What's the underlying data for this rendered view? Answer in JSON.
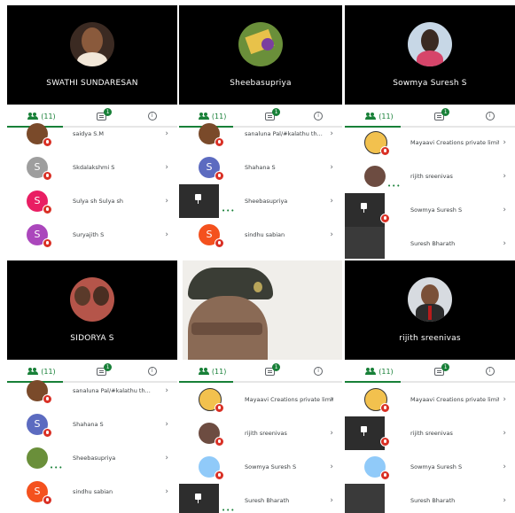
{
  "colors": {
    "accent": "#188038",
    "muted_red": "#d93025",
    "purple": "#9c27b0",
    "blue": "#5c6bc0",
    "pink": "#e91e63",
    "orange": "#f4511e"
  },
  "tabs": {
    "people_count": "(11)",
    "chat_badge": "1"
  },
  "videos": [
    {
      "name": "SWATHI SUNDARESAN"
    },
    {
      "name": "Sheebasupriya"
    },
    {
      "name": "Sowmya Suresh S"
    },
    {
      "name": "SIDORYA S"
    },
    {
      "name": ""
    },
    {
      "name": "rijith sreenivas"
    }
  ],
  "panels": [
    {
      "rows": [
        {
          "name": "saidya S.M",
          "avatar": "photo"
        },
        {
          "name": "Skdalakshmi S",
          "avatar": "S",
          "color": "#9e9e9e"
        },
        {
          "name": "Sulya sh Sulya sh",
          "avatar": "S",
          "color": "#e91e63"
        },
        {
          "name": "Suryajith S",
          "avatar": "S",
          "color": "#ab47bc"
        }
      ]
    },
    {
      "rows": [
        {
          "name": "sanaluna Pal/#kalathu th...",
          "avatar": "photo"
        },
        {
          "name": "Shahana S",
          "avatar": "S",
          "color": "#5c6bc0"
        },
        {
          "name": "Sheebasupriya",
          "avatar": "pin"
        },
        {
          "name": "sindhu sabian",
          "avatar": "S",
          "color": "#f4511e"
        }
      ]
    },
    {
      "rows": [
        {
          "name": "Mayaavi Creations private limite...",
          "avatar": "photo"
        },
        {
          "name": "rijith sreenivas",
          "avatar": "photo"
        },
        {
          "name": "Sowmya Suresh S",
          "avatar": "pin"
        },
        {
          "name": "Suresh Bharath",
          "avatar": "photo"
        }
      ]
    },
    {
      "rows": [
        {
          "name": "sanaluna Pal/#kalathu th...",
          "avatar": "photo"
        },
        {
          "name": "Shahana S",
          "avatar": "S",
          "color": "#5c6bc0"
        },
        {
          "name": "Sheebasupriya",
          "avatar": "photo"
        },
        {
          "name": "sindhu sabian",
          "avatar": "S",
          "color": "#f4511e"
        }
      ]
    },
    {
      "rows": [
        {
          "name": "Mayaavi Creations private limite...",
          "avatar": "photo"
        },
        {
          "name": "rijith sreenivas",
          "avatar": "photo"
        },
        {
          "name": "Sowmya Suresh S",
          "avatar": "photo"
        },
        {
          "name": "Suresh Bharath",
          "avatar": "pin"
        }
      ]
    },
    {
      "rows": [
        {
          "name": "Mayaavi Creations private limite...",
          "avatar": "photo"
        },
        {
          "name": "rijith sreenivas",
          "avatar": "pin"
        },
        {
          "name": "Sowmya Suresh S",
          "avatar": "photo"
        },
        {
          "name": "Suresh Bharath",
          "avatar": "photo"
        }
      ]
    }
  ]
}
